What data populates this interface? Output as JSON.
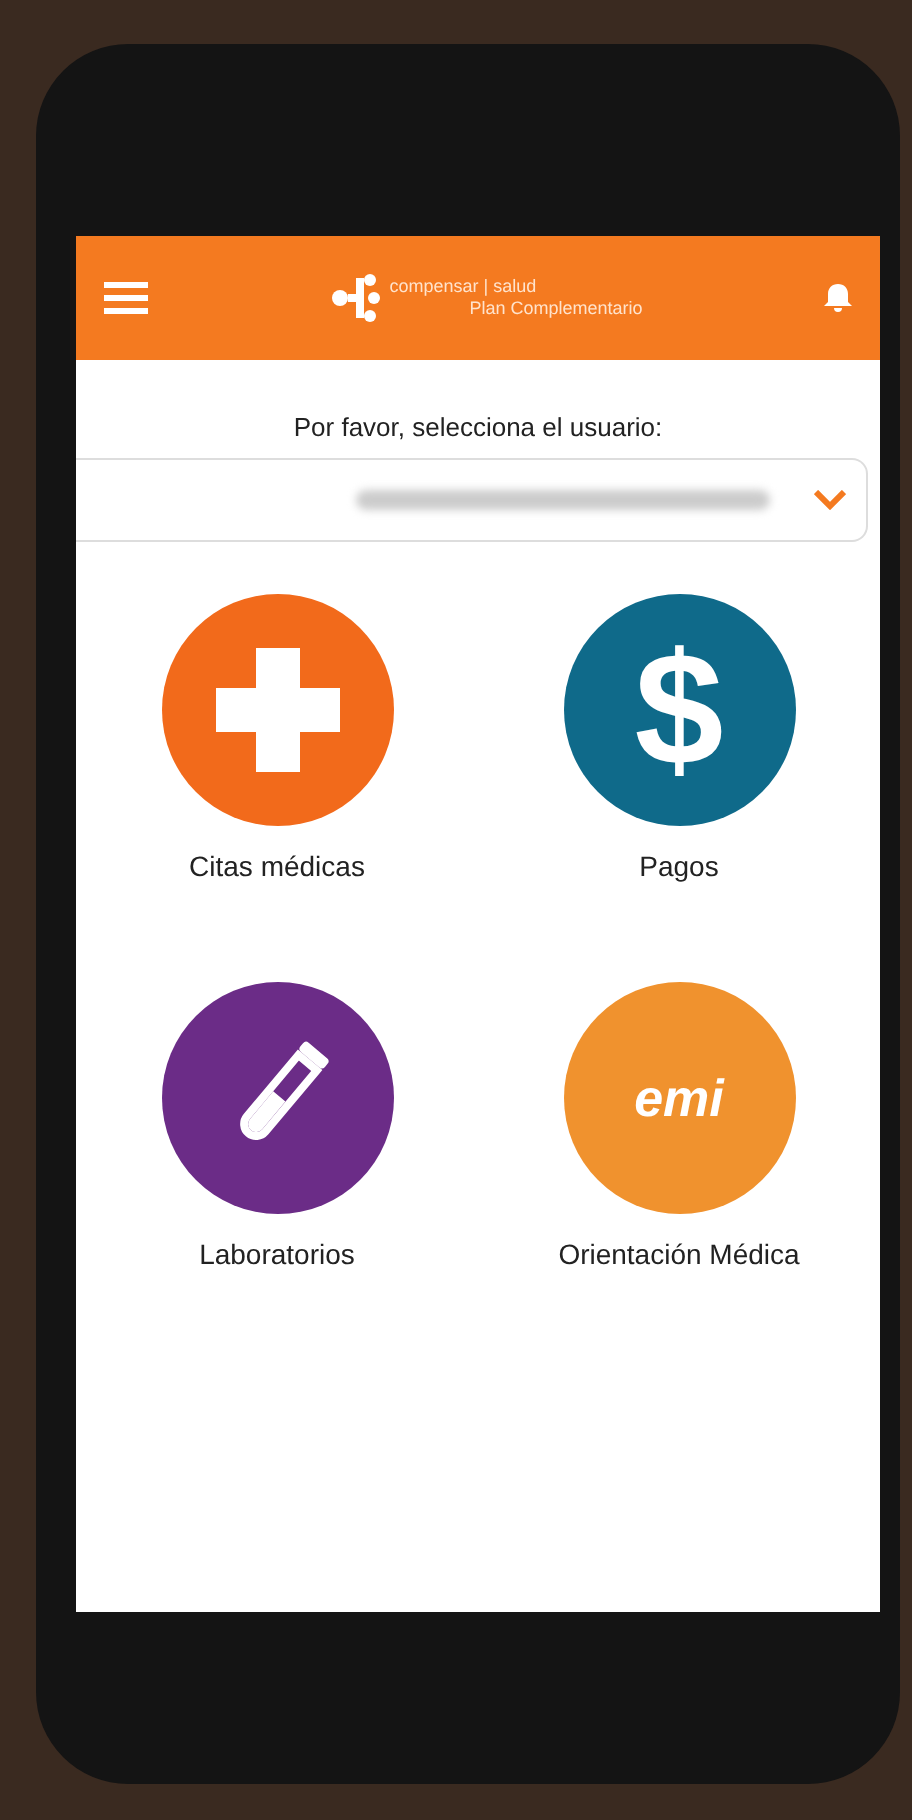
{
  "header": {
    "brand": "compensar | salud",
    "subtitle": "Plan Complementario"
  },
  "prompt": "Por favor, selecciona el usuario:",
  "tiles": [
    {
      "label": "Citas médicas",
      "kind": "cross",
      "color": "#f26a1b"
    },
    {
      "label": "Pagos",
      "kind": "dollar",
      "color": "#0f6a8a",
      "glyph": "$"
    },
    {
      "label": "Laboratorios",
      "kind": "tube",
      "color": "#6b2c87"
    },
    {
      "label": "Orientación Médica",
      "kind": "emi",
      "color": "#f0922e",
      "logo_text": "emi"
    }
  ]
}
